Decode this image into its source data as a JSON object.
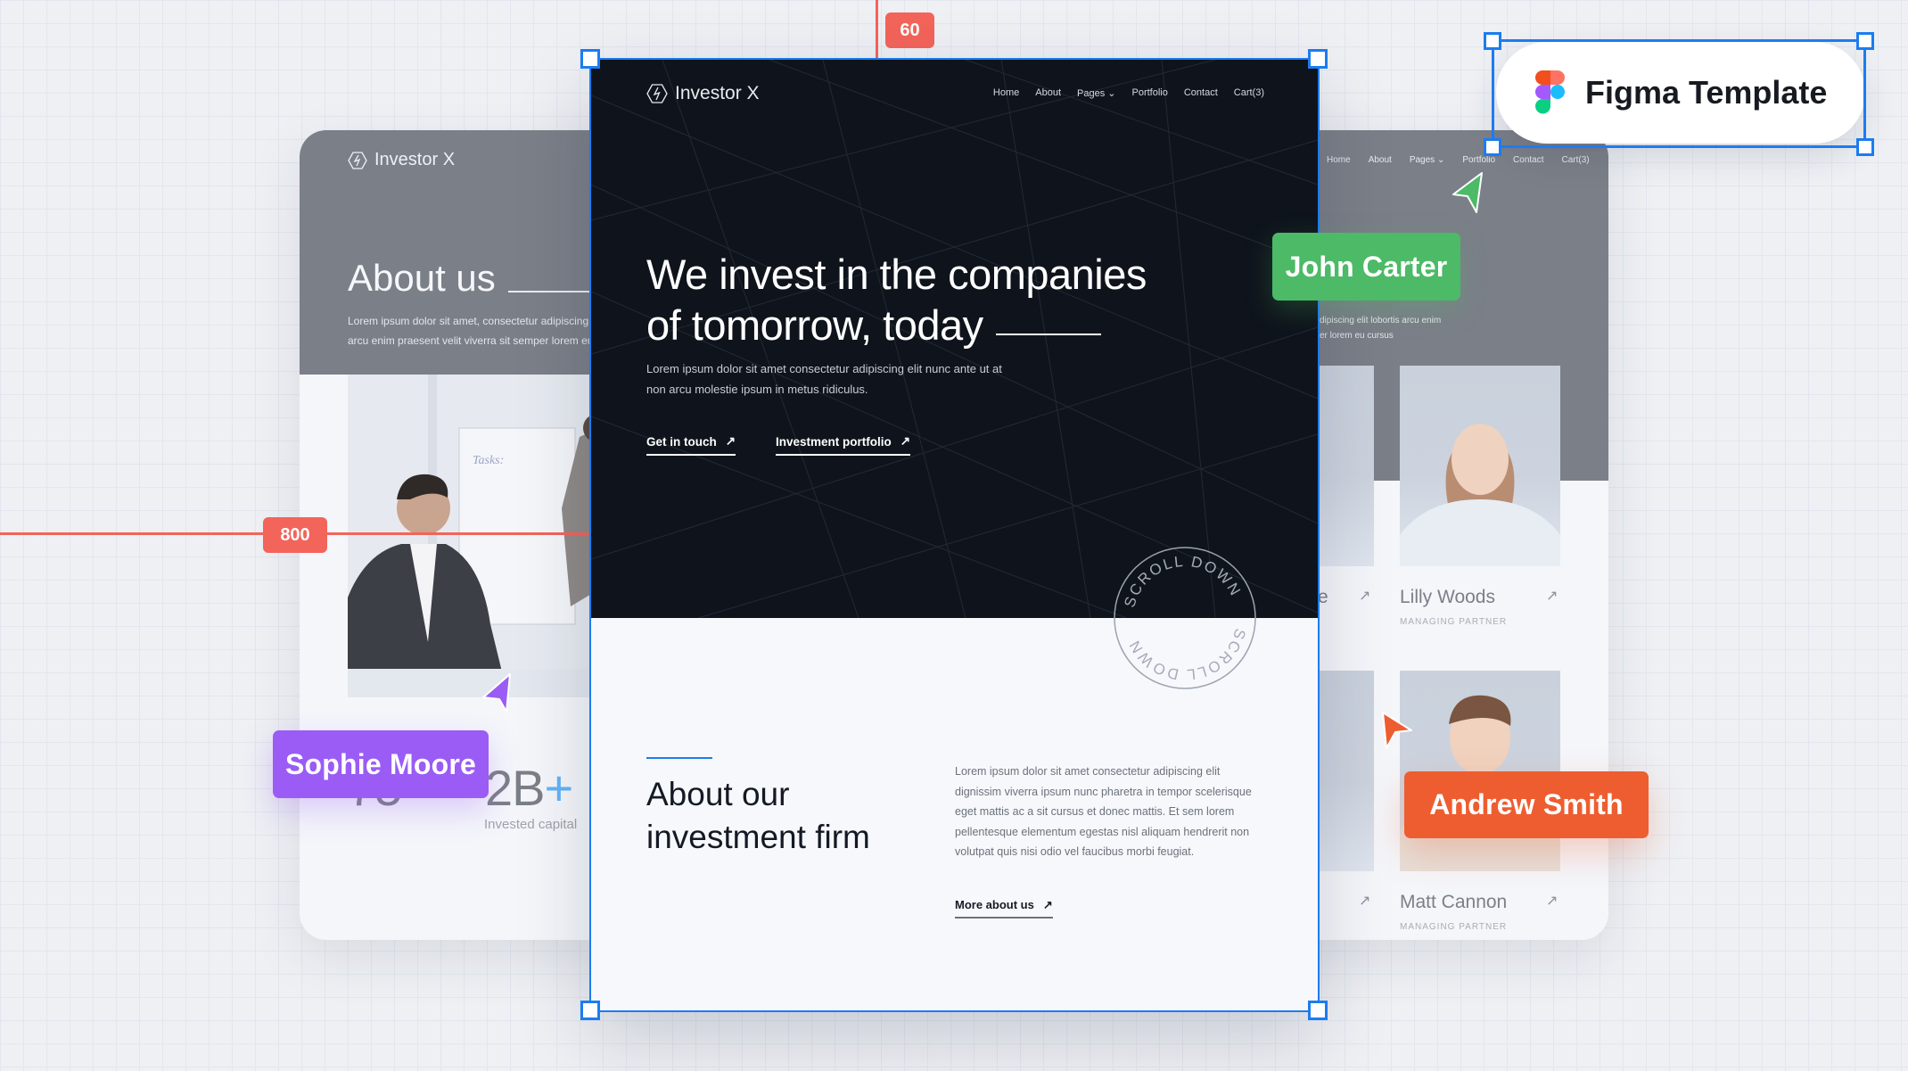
{
  "canvas": {
    "ruler_top_value": "60",
    "ruler_left_value": "800",
    "figma_badge_label": "Figma Template"
  },
  "main_frame": {
    "brand": "Investor X",
    "nav": [
      "Home",
      "About",
      "Pages",
      "Portfolio",
      "Contact",
      "Cart(3)"
    ],
    "hero": {
      "title_line1": "We invest in the companies",
      "title_line2": "of tomorrow, today",
      "subtitle": "Lorem ipsum dolor sit amet consectetur adipiscing elit nunc ante ut at non arcu molestie ipsum in metus ridiculus.",
      "cta_primary": "Get in touch",
      "cta_secondary": "Investment portfolio"
    },
    "scroll_badge_text": "SCROLL DOWN",
    "about": {
      "title_line1": "About our",
      "title_line2": "investment firm",
      "body": "Lorem ipsum dolor sit amet consectetur adipiscing elit dignissim viverra ipsum nunc pharetra in tempor scelerisque eget mattis ac a sit cursus et donec mattis. Et sem lorem pellentesque elementum egestas nisl aliquam hendrerit non volutpat quis nisi odio vel faucibus morbi feugiat.",
      "link": "More about us"
    }
  },
  "left_card": {
    "brand": "Investor X",
    "heading": "About us",
    "text_line1": "Lorem ipsum dolor sit amet, consectetur adipiscing elit",
    "text_line2": "arcu enim praesent velit viverra sit semper lorem eu cursus",
    "stat_partial": "75",
    "stat_value": "2B",
    "stat_plus": "+",
    "stat_label": "Invested capital"
  },
  "right_card": {
    "nav": [
      "Home",
      "About",
      "Pages",
      "Portfolio",
      "Contact",
      "Cart(3)"
    ],
    "text_line1": "dipiscing elit lobortis arcu enim",
    "text_line2": "er lorem eu cursus",
    "partial_name_1": "e",
    "members": [
      {
        "name": "Lilly Woods",
        "role": "MANAGING PARTNER"
      },
      {
        "name": "Matt Cannon",
        "role": "MANAGING PARTNER"
      }
    ]
  },
  "collaborators": [
    {
      "name": "John Carter",
      "color": "#4cba66"
    },
    {
      "name": "Sophie Moore",
      "color": "#9a5cf5"
    },
    {
      "name": "Andrew Smith",
      "color": "#ee5d30"
    }
  ],
  "colors": {
    "selection": "#1c7cf0",
    "ruler": "#f3645a",
    "hero_bg": "#0f141c",
    "accent_blue": "#1c7cf0"
  }
}
